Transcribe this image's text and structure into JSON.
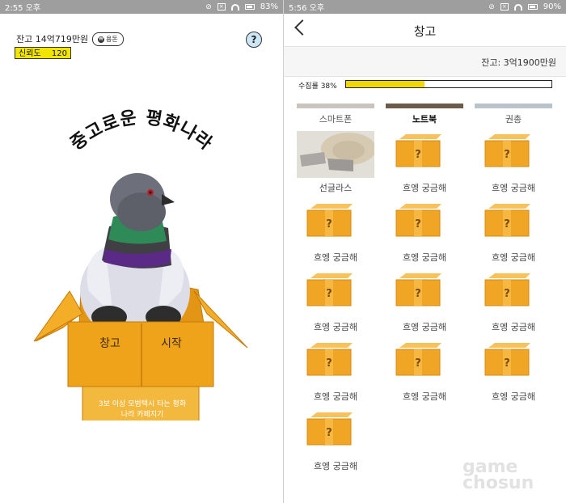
{
  "left_screen": {
    "status_time": "2:55 오후",
    "battery": "83%",
    "balance": "잔고 14억719만원",
    "allowance_chip": "용돈",
    "trust_label": "신뢰도",
    "trust_value": "120",
    "help_label": "?",
    "title": "중고로운 평화나라",
    "warehouse_button": "창고",
    "start_button": "시작",
    "box_description_line1": "3보 이상 모범택시 타는 평화",
    "box_description_line2": "나라 카페지기",
    "colors": {
      "box": "#efa31b",
      "trust_bg": "#f2e600",
      "help_bg": "#cde6f5"
    }
  },
  "right_screen": {
    "status_time": "5:56 오후",
    "battery": "90%",
    "title": "창고",
    "balance": "잔고: 3억1900만원",
    "progress_label": "수집률 38%",
    "progress_fraction": 0.38,
    "categories": [
      {
        "label": "스마트폰",
        "selected": false
      },
      {
        "label": "노트북",
        "selected": true
      },
      {
        "label": "권총",
        "selected": false
      }
    ],
    "items": [
      {
        "label": "선글라스",
        "type": "photo"
      },
      {
        "label": "흐엥 궁금해",
        "type": "mystery"
      },
      {
        "label": "흐엥 궁금해",
        "type": "mystery"
      },
      {
        "label": "흐엥 궁금해",
        "type": "mystery"
      },
      {
        "label": "흐엥 궁금해",
        "type": "mystery"
      },
      {
        "label": "흐엥 궁금해",
        "type": "mystery"
      },
      {
        "label": "흐엥 궁금해",
        "type": "mystery"
      },
      {
        "label": "흐엥 궁금해",
        "type": "mystery"
      },
      {
        "label": "흐엥 궁금해",
        "type": "mystery"
      },
      {
        "label": "흐엥 궁금해",
        "type": "mystery"
      },
      {
        "label": "흐엥 궁금해",
        "type": "mystery"
      },
      {
        "label": "흐엥 궁금해",
        "type": "mystery"
      },
      {
        "label": "흐엥 궁금해",
        "type": "mystery"
      }
    ],
    "mystery_mark": "?",
    "colors": {
      "progress": "#f0d800",
      "box": "#f0a624"
    }
  },
  "watermark": {
    "line1": "game",
    "line2": "chosun"
  }
}
